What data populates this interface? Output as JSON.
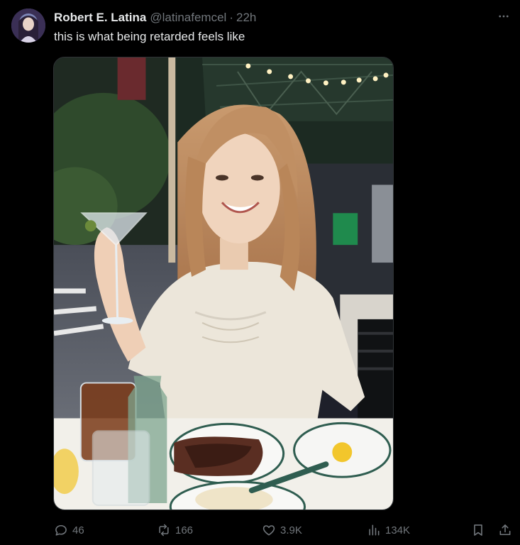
{
  "tweet": {
    "author": {
      "display_name": "Robert E. Latina",
      "handle": "@latinafemcel",
      "avatar_icon": "avatar-photo"
    },
    "separator": "·",
    "time": "22h",
    "text": "this is what being retarded feels like",
    "media": {
      "kind": "photo"
    },
    "actions": {
      "replies": "46",
      "reposts": "166",
      "likes": "3.9K",
      "views": "134K"
    },
    "icons": {
      "more": "more-icon",
      "reply": "reply-icon",
      "repost": "repost-icon",
      "like": "heart-icon",
      "views": "views-icon",
      "bookmark": "bookmark-icon",
      "share": "share-icon"
    },
    "colors": {
      "background": "#000000",
      "text": "#e7e9ea",
      "secondary": "#71767b",
      "border": "#2f3336"
    }
  }
}
